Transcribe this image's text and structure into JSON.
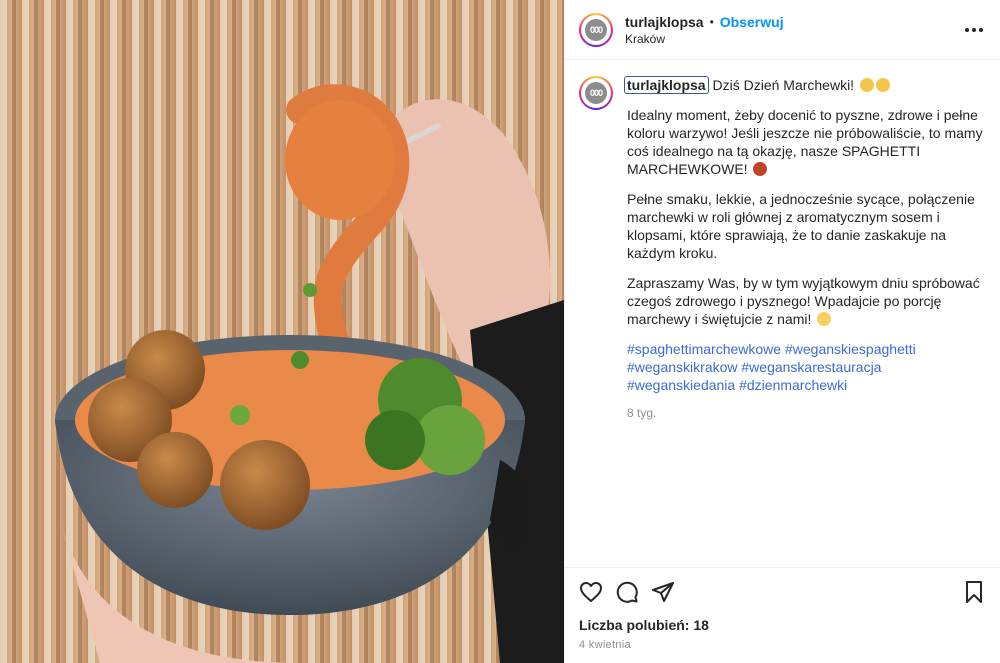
{
  "post": {
    "username": "turlajklopsa",
    "dot": "•",
    "follow_label": "Obserwuj",
    "location": "Kraków",
    "avatar_text": "000"
  },
  "caption": {
    "username": "turlajklopsa",
    "first_line": "Dziś Dzień Marchewki!",
    "paragraph1": "Idealny moment, żeby docenić to pyszne, zdrowe i pełne koloru warzywo! Jeśli jeszcze nie próbowaliście, to mamy coś idealnego na tą okazję, nasze SPAGHETTI MARCHEWKOWE!",
    "paragraph2": "Pełne smaku, lekkie, a jednocześnie sycące, połączenie marchewki w roli głównej z aromatycznym sosem i klopsami, które sprawiają, że to danie zaskakuje na każdym kroku.",
    "paragraph3": "Zapraszamy Was, by w tym wyjątkowym dniu spróbować czegoś zdrowego i pysznego! Wpadajcie po porcję marchewy i świętujcie z nami!",
    "hashtags": [
      "#spaghettimarchewkowe",
      "#weganskiespaghetti",
      "#weganskikrakow",
      "#weganskarestauracja",
      "#weganskiedania",
      "#dzienmarchewki"
    ],
    "time_ago": "8 tyg."
  },
  "actions": {
    "icons": [
      "heart-icon",
      "comment-icon",
      "share-icon",
      "bookmark-icon"
    ]
  },
  "footer": {
    "likes": "Liczba polubień: 18",
    "date": "4 kwietnia"
  },
  "colors": {
    "follow": "#0095f6",
    "hashtag": "#3c6bd1",
    "muted": "#8e8e8e"
  }
}
